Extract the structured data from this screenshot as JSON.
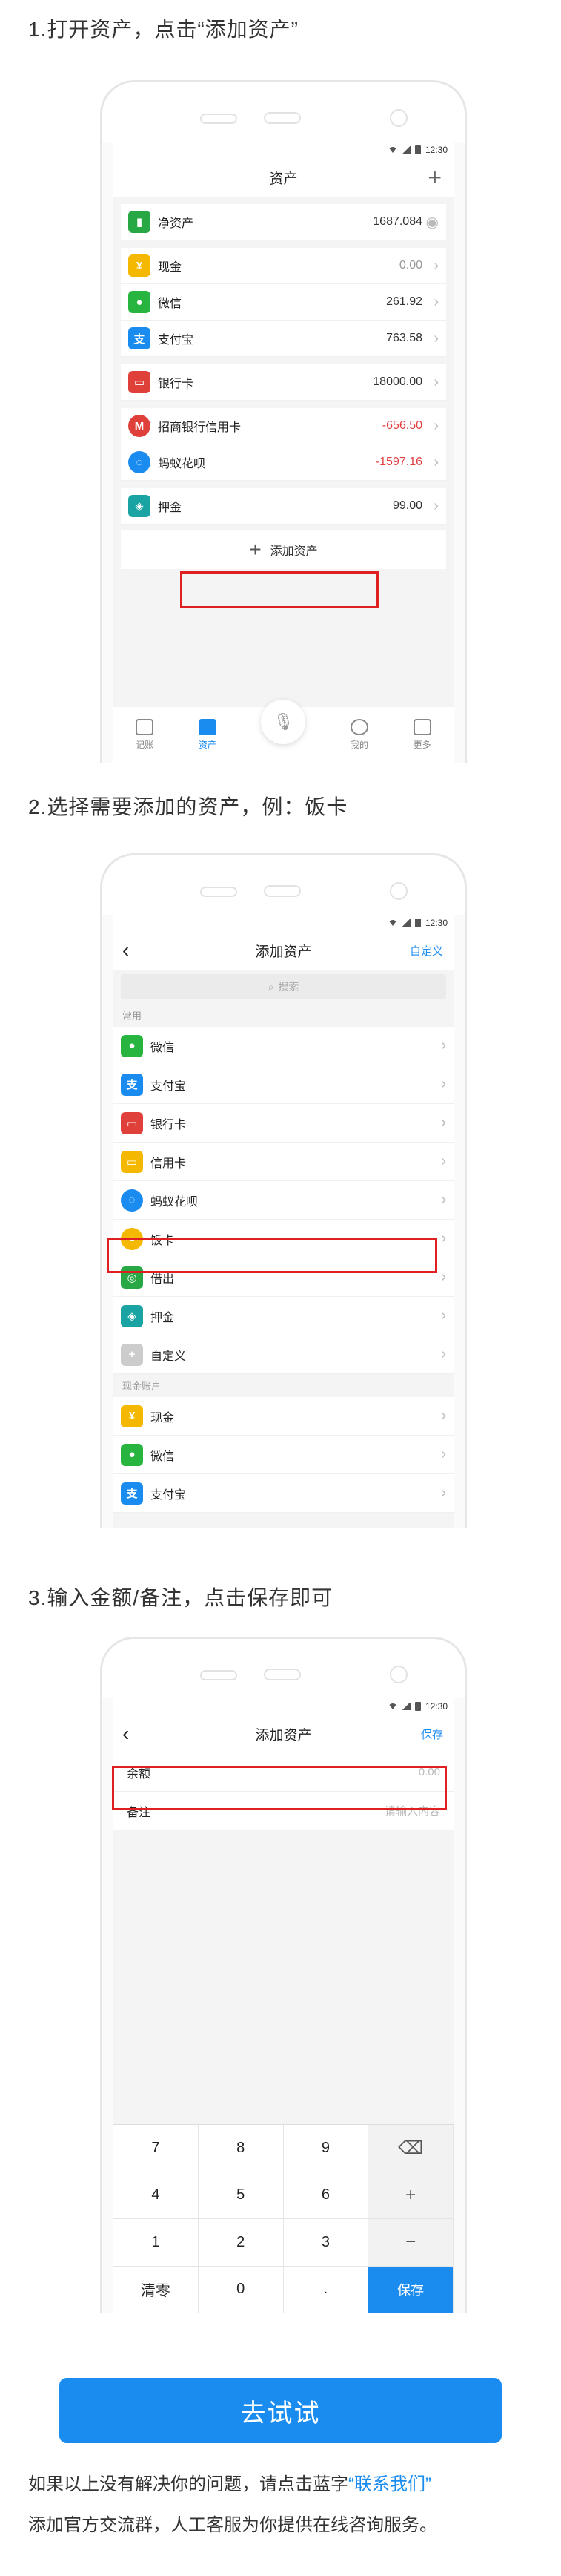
{
  "step1": {
    "title": "1.打开资产，点击“添加资产”",
    "status_time": "12:30",
    "nav_title": "资产",
    "nav_plus": "+",
    "rows": [
      {
        "label": "净资产",
        "amount": "1687.084",
        "icon": "chart-icon",
        "color": "#27a844"
      },
      {
        "label": "现金",
        "amount": "0.00",
        "icon": "cash-icon",
        "color": "#f5b800"
      },
      {
        "label": "微信",
        "amount": "261.92",
        "icon": "wechat-icon",
        "color": "#27b53f"
      },
      {
        "label": "支付宝",
        "amount": "763.58",
        "icon": "alipay-icon",
        "color": "#1a8cf0"
      },
      {
        "label": "银行卡",
        "amount": "18000.00",
        "icon": "bankcard-icon",
        "color": "#e0403a"
      },
      {
        "label": "招商银行信用卡",
        "amount": "-656.50",
        "icon": "cmb-icon",
        "color": "#e0403a"
      },
      {
        "label": "蚂蚁花呗",
        "amount": "-1597.16",
        "icon": "huabei-icon",
        "color": "#1a8cf0"
      },
      {
        "label": "押金",
        "amount": "99.00",
        "icon": "deposit-icon",
        "color": "#1aa3a3"
      }
    ],
    "add_label": "添加资产",
    "tabs": [
      "记账",
      "资产",
      "我的",
      "更多"
    ]
  },
  "step2": {
    "title": "2.选择需要添加的资产，例：饭卡",
    "status_time": "12:30",
    "nav_title": "添加资产",
    "nav_right": "自定义",
    "search_placeholder": "搜索",
    "section_common": "常用",
    "common": [
      {
        "label": "微信",
        "icon": "wechat-icon",
        "color": "#27b53f"
      },
      {
        "label": "支付宝",
        "icon": "alipay-icon",
        "color": "#1a8cf0"
      },
      {
        "label": "银行卡",
        "icon": "bankcard-icon",
        "color": "#e0403a"
      },
      {
        "label": "信用卡",
        "icon": "creditcard-icon",
        "color": "#f5b800"
      },
      {
        "label": "蚂蚁花呗",
        "icon": "huabei-icon",
        "color": "#1a8cf0"
      },
      {
        "label": "饭卡",
        "icon": "mealcard-icon",
        "color": "#f5b800"
      },
      {
        "label": "借出",
        "icon": "lend-icon",
        "color": "#27a844"
      },
      {
        "label": "押金",
        "icon": "deposit-icon",
        "color": "#1aa3a3"
      },
      {
        "label": "自定义",
        "icon": "custom-icon",
        "color": "#cccccc"
      }
    ],
    "section_cash": "现金账户",
    "cash": [
      {
        "label": "现金",
        "icon": "cash-icon",
        "color": "#f5b800"
      },
      {
        "label": "微信",
        "icon": "wechat-icon",
        "color": "#27b53f"
      },
      {
        "label": "支付宝",
        "icon": "alipay-icon",
        "color": "#1a8cf0"
      }
    ]
  },
  "step3": {
    "title": "3.输入金额/备注，点击保存即可",
    "status_time": "12:30",
    "nav_title": "添加资产",
    "nav_right": "保存",
    "balance_label": "余额",
    "balance_placeholder": "0.00",
    "note_label": "备注",
    "note_placeholder": "请输入内容",
    "keys": [
      "7",
      "8",
      "9",
      "⌫",
      "4",
      "5",
      "6",
      "+",
      "1",
      "2",
      "3",
      "−",
      "清零",
      "0",
      ".",
      "保存"
    ]
  },
  "cta_label": "去试试",
  "footer": {
    "line1_prefix": "如果以上没有解决你的问题，请点击蓝字",
    "link": "“联系我们”",
    "line2": "添加官方交流群，人工客服为你提供在线咨询服务。"
  }
}
